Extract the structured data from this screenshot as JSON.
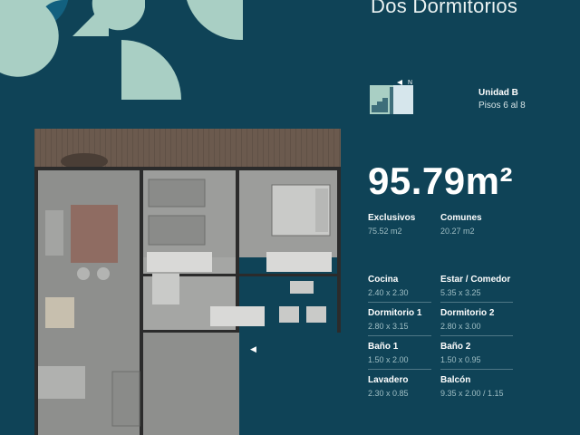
{
  "title": "Dos Dormitorios",
  "unit": {
    "name": "Unidad B",
    "floors": "Pisos 6 al 8"
  },
  "keyplan": {
    "north_label": "N"
  },
  "area_total": "95.79m²",
  "summary": [
    {
      "label": "Exclusivos",
      "value": "75.52 m2"
    },
    {
      "label": "Comunes",
      "value": "20.27 m2"
    }
  ],
  "rooms": [
    {
      "label": "Cocina",
      "value": "2.40 x 2.30"
    },
    {
      "label": "Estar / Comedor",
      "value": "5.35 x 3.25"
    },
    {
      "label": "Dormitorio 1",
      "value": "2.80 x 3.15"
    },
    {
      "label": "Dormitorio 2",
      "value": "2.80 x 3.00"
    },
    {
      "label": "Baño 1",
      "value": "1.50 x 2.00"
    },
    {
      "label": "Baño 2",
      "value": "1.50 x 0.95"
    },
    {
      "label": "Lavadero",
      "value": "2.30 x 0.85"
    },
    {
      "label": "Balcón",
      "value": "9.35 x 2.00 / 1.15"
    }
  ],
  "colors": {
    "background": "#0f4357",
    "accent_mint": "#a9cfc4",
    "accent_blue": "#12607f"
  }
}
